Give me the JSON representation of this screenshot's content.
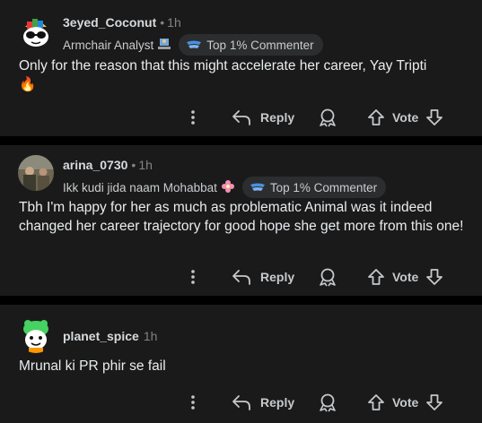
{
  "comments": [
    {
      "username": "3eyed_Coconut",
      "time": "1h",
      "flair": "Armchair Analyst",
      "badge": "Top 1% Commenter",
      "text": "Only for the reason that this might accelerate her career, Yay Tripti",
      "emoji": "🔥"
    },
    {
      "username": "arina_0730",
      "time": "1h",
      "flair": "Ikk kudi jida naam Mohabbat",
      "badge": "Top 1% Commenter",
      "text": "Tbh I'm happy for her as much as problematic Animal was it indeed changed her career trajectory for good hope she get more from this one!"
    },
    {
      "username": "planet_spice",
      "time": "1h",
      "text": "Mrunal ki PR phir se fail"
    }
  ],
  "actions": {
    "reply_label": "Reply",
    "vote_label": "Vote",
    "separator": "•"
  }
}
